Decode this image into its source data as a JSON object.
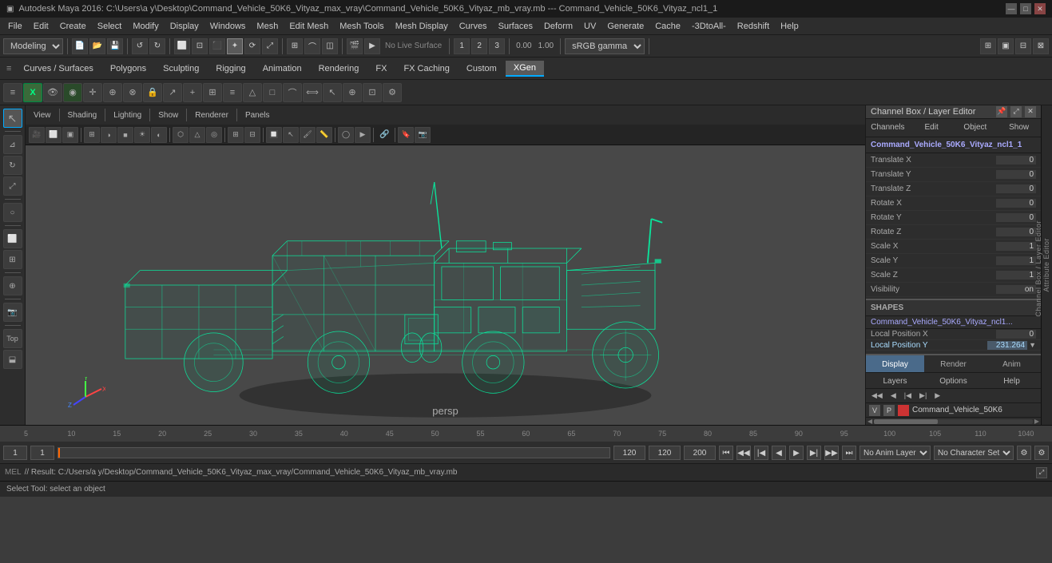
{
  "titlebar": {
    "text": "Autodesk Maya 2016: C:\\Users\\a y\\Desktop\\Command_Vehicle_50K6_Vityaz_max_vray\\Command_Vehicle_50K6_Vityaz_mb_vray.mb --- Command_Vehicle_50K6_Vityaz_ncl1_1",
    "logo": "maya-logo"
  },
  "menubar": {
    "items": [
      "File",
      "Edit",
      "Create",
      "Select",
      "Modify",
      "Display",
      "Windows",
      "Mesh",
      "Edit Mesh",
      "Mesh Tools",
      "Mesh Display",
      "Curves",
      "Surfaces",
      "Deform",
      "UV",
      "Generate",
      "Cache",
      "-3DtoAll-",
      "Redshift",
      "Help"
    ]
  },
  "toolbar1": {
    "mode_dropdown": "Modeling",
    "live_surface": "No Live Surface",
    "color_space": "sRGB gamma",
    "value1": "0.00",
    "value2": "1.00"
  },
  "toolbar2": {
    "tabs": [
      "Curves / Surfaces",
      "Polygons",
      "Sculpting",
      "Rigging",
      "Animation",
      "Rendering",
      "FX",
      "FX Caching",
      "Custom",
      "XGen"
    ]
  },
  "viewport": {
    "label": "persp",
    "viewmenu": [
      "View",
      "Shading",
      "Lighting",
      "Show",
      "Renderer",
      "Panels"
    ]
  },
  "channel_box": {
    "title": "Channel Box / Layer Editor",
    "tabs_actions": [
      "Channels",
      "Edit",
      "Object",
      "Show"
    ],
    "object_name": "Command_Vehicle_50K6_Vityaz_ncl1_1",
    "channels": [
      {
        "name": "Translate X",
        "value": "0"
      },
      {
        "name": "Translate Y",
        "value": "0"
      },
      {
        "name": "Translate Z",
        "value": "0"
      },
      {
        "name": "Rotate X",
        "value": "0"
      },
      {
        "name": "Rotate Y",
        "value": "0"
      },
      {
        "name": "Rotate Z",
        "value": "0"
      },
      {
        "name": "Scale X",
        "value": "1"
      },
      {
        "name": "Scale Y",
        "value": "1"
      },
      {
        "name": "Scale Z",
        "value": "1"
      },
      {
        "name": "Visibility",
        "value": "on"
      }
    ],
    "shapes_label": "SHAPES",
    "shapes_obj": "Command_Vehicle_50K6_Vityaz_ncl1...",
    "local_pos_x": {
      "name": "Local Position X",
      "value": "0"
    },
    "local_pos_y": {
      "name": "Local Position Y",
      "value": "231.264"
    },
    "display_tabs": [
      "Display",
      "Render",
      "Anim"
    ],
    "layer_tabs": [
      "Layers",
      "Options",
      "Help"
    ],
    "layer_icons": [
      "◀◀",
      "◀",
      "◀|",
      "▶",
      "▶▶",
      "▶▶|"
    ],
    "layer_entry": {
      "v": "V",
      "p": "P",
      "color": "#cc3333",
      "name": "Command_Vehicle_50K6"
    }
  },
  "timeline": {
    "numbers": [
      "5",
      "10",
      "15",
      "20",
      "25",
      "30",
      "35",
      "40",
      "45",
      "50",
      "55",
      "60",
      "65",
      "70",
      "75",
      "80",
      "85",
      "90",
      "95",
      "100",
      "105",
      "110",
      "1040"
    ],
    "start_frame": "1",
    "current_frame1": "1",
    "current_frame2": "1",
    "end_frame": "120",
    "end_frame2": "120",
    "max_frame": "200",
    "anim_layer": "No Anim Layer",
    "char_set": "No Character Set",
    "play_controls": [
      "⏮",
      "◀◀",
      "◀|",
      "◀",
      "▶",
      "▶|",
      "▶▶",
      "⏭"
    ]
  },
  "statusbar": {
    "prefix": "MEL",
    "result_text": "// Result: C:/Users/a y/Desktop/Command_Vehicle_50K6_Vityaz_max_vray/Command_Vehicle_50K6_Vityaz_mb_vray.mb"
  },
  "bottomstatus": {
    "text": "Select Tool: select an object"
  }
}
